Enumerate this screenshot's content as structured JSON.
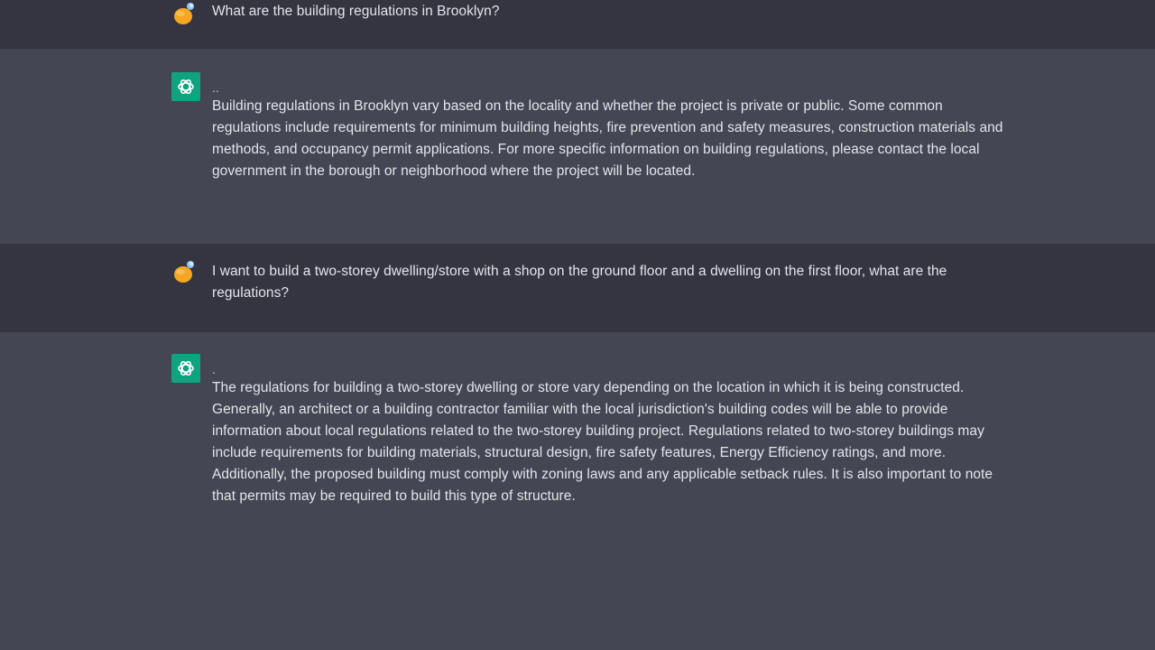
{
  "messages": [
    {
      "role": "user",
      "text": "What are the building regulations in Brooklyn?"
    },
    {
      "role": "assistant",
      "prefix": "..",
      "text": "Building regulations in Brooklyn vary based on the locality and whether the project is private or public. Some common regulations include requirements for minimum building heights, fire prevention and safety measures, construction materials and methods, and occupancy permit applications. For more specific information on building regulations, please contact the local government in the borough or neighborhood where the project will be located."
    },
    {
      "role": "user",
      "text": "I want to build a two-storey dwelling/store with a shop on the ground floor and a dwelling on the first floor, what are the regulations?"
    },
    {
      "role": "assistant",
      "prefix": ".",
      "text": "The regulations for building a two-storey dwelling or store vary depending on the location in which it is being constructed. Generally, an architect or a building contractor familiar with the local jurisdiction's building codes will be able to provide information about local regulations related to the two-storey building project. Regulations related to two-storey buildings may include requirements for building materials, structural design, fire safety features, Energy Efficiency ratings, and more. Additionally, the proposed building must comply with zoning laws and any applicable setback rules. It is also important to note that permits may be required to build this type of structure."
    }
  ],
  "colors": {
    "user_row_bg": "#343541",
    "assistant_row_bg": "#444654",
    "assistant_avatar_bg": "#10a37f",
    "user_avatar_accent": "#f5a623"
  },
  "icons": {
    "user_avatar": "user-avatar-icon",
    "assistant_avatar": "openai-logo-icon"
  }
}
